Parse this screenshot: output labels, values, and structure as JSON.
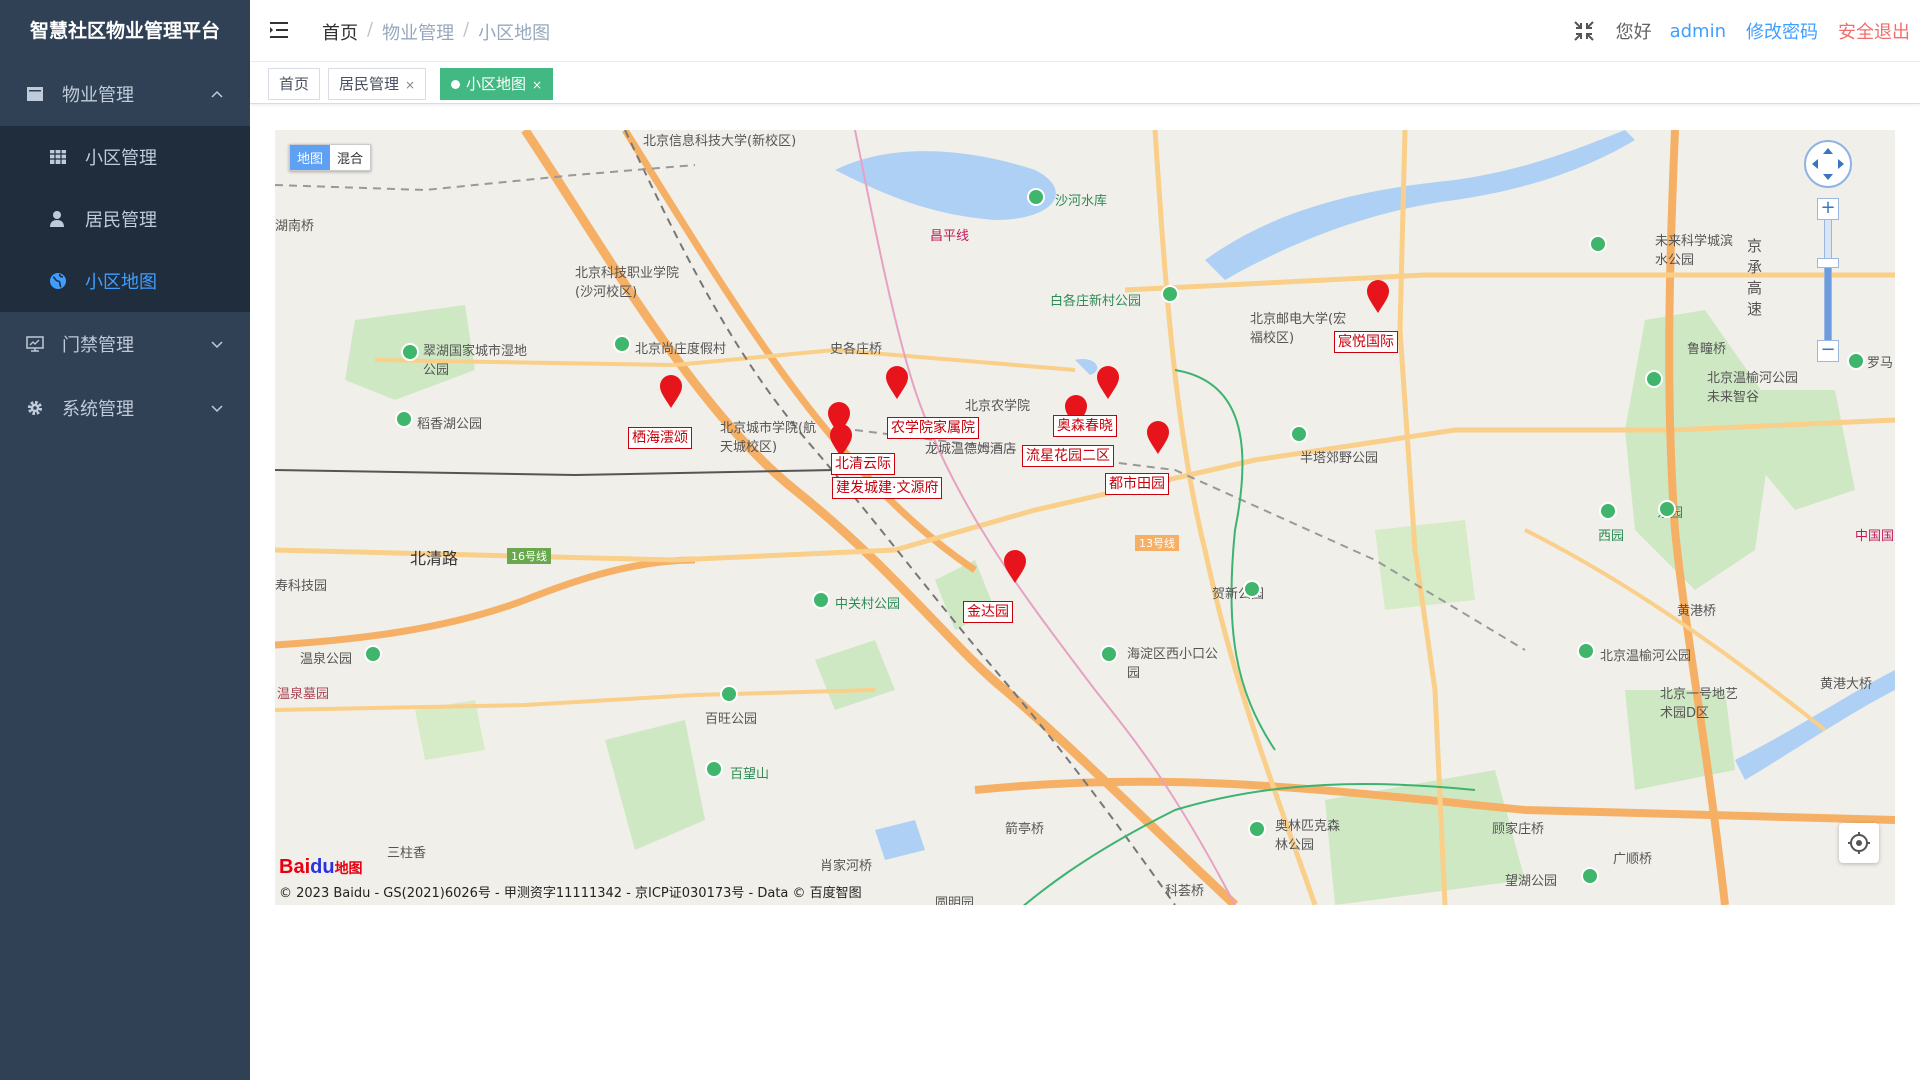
{
  "sidebar": {
    "brand": "智慧社区物业管理平台",
    "menu": [
      {
        "label": "物业管理",
        "icon": "grid-icon",
        "expanded": true,
        "children": [
          {
            "label": "小区管理",
            "icon": "table-icon",
            "active": false
          },
          {
            "label": "居民管理",
            "icon": "user-icon",
            "active": false
          },
          {
            "label": "小区地图",
            "icon": "globe-icon",
            "active": true
          }
        ]
      },
      {
        "label": "门禁管理",
        "icon": "monitor-icon",
        "expanded": false
      },
      {
        "label": "系统管理",
        "icon": "gear-icon",
        "expanded": false
      }
    ]
  },
  "navbar": {
    "breadcrumb": [
      "首页",
      "物业管理",
      "小区地图"
    ],
    "greeting": "您好",
    "username": "admin",
    "change_password": "修改密码",
    "logout": "安全退出"
  },
  "tags": [
    {
      "label": "首页",
      "active": false,
      "closable": false
    },
    {
      "label": "居民管理",
      "active": false,
      "closable": true
    },
    {
      "label": "小区地图",
      "active": true,
      "closable": true
    }
  ],
  "tag_close_glyph": "×",
  "colors": {
    "sidebar_bg": "#304156",
    "active_menu": "#409eff",
    "active_tag": "#42b983",
    "logout": "#f56c6c",
    "marker": "#e8141c"
  },
  "map": {
    "type_control": [
      "地图",
      "混合"
    ],
    "zoom_in": "+",
    "zoom_out": "−",
    "logo_text": "Bai",
    "logo_paw": "du",
    "logo_suffix": "地图",
    "copyright": "© 2023 Baidu - GS(2021)6026号 - 甲测资字11111342 - 京ICP证030173号 - Data © 百度智图",
    "communities": [
      "栖海澐颂",
      "农学院家属院",
      "北清云际",
      "建发城建·文源府",
      "奥森春晓",
      "流星花园二区",
      "都市田园",
      "宸悦国际",
      "金达园"
    ],
    "places": [
      "北京信息科技大学(新校区)",
      "沙河水库",
      "昌平线",
      "北京科技职业学院(沙河校区)",
      "白各庄新村公园",
      "北京邮电大学(宏福校区)",
      "未来科学城滨水公园",
      "京承高速",
      "北京尚庄度假村",
      "史各庄桥",
      "翠湖国家城市湿地公园",
      "北京农学院",
      "北京城市学院(航天城校区)",
      "稻香湖公园",
      "龙城温德姆酒店",
      "半塔郊野公园",
      "鲁疃桥",
      "北京温榆河公园未来智谷",
      "北清路",
      "16号线",
      "13号线",
      "寿科技园",
      "中关村公园",
      "贺新公园",
      "西园",
      "东园",
      "黄港桥",
      "温泉公园",
      "海淀区西小口公园",
      "北京温榆河公园",
      "温泉墓园",
      "百旺公园",
      "北京一号地艺术园D区",
      "黄港大桥",
      "百望山",
      "箭亭桥",
      "奥林匹克森林公园",
      "顾家庄桥",
      "广顺桥",
      "三柱香",
      "肖家河桥",
      "科荟桥",
      "望湖公园",
      "圆明园",
      "中国国",
      "湖南桥",
      "罗马"
    ]
  }
}
